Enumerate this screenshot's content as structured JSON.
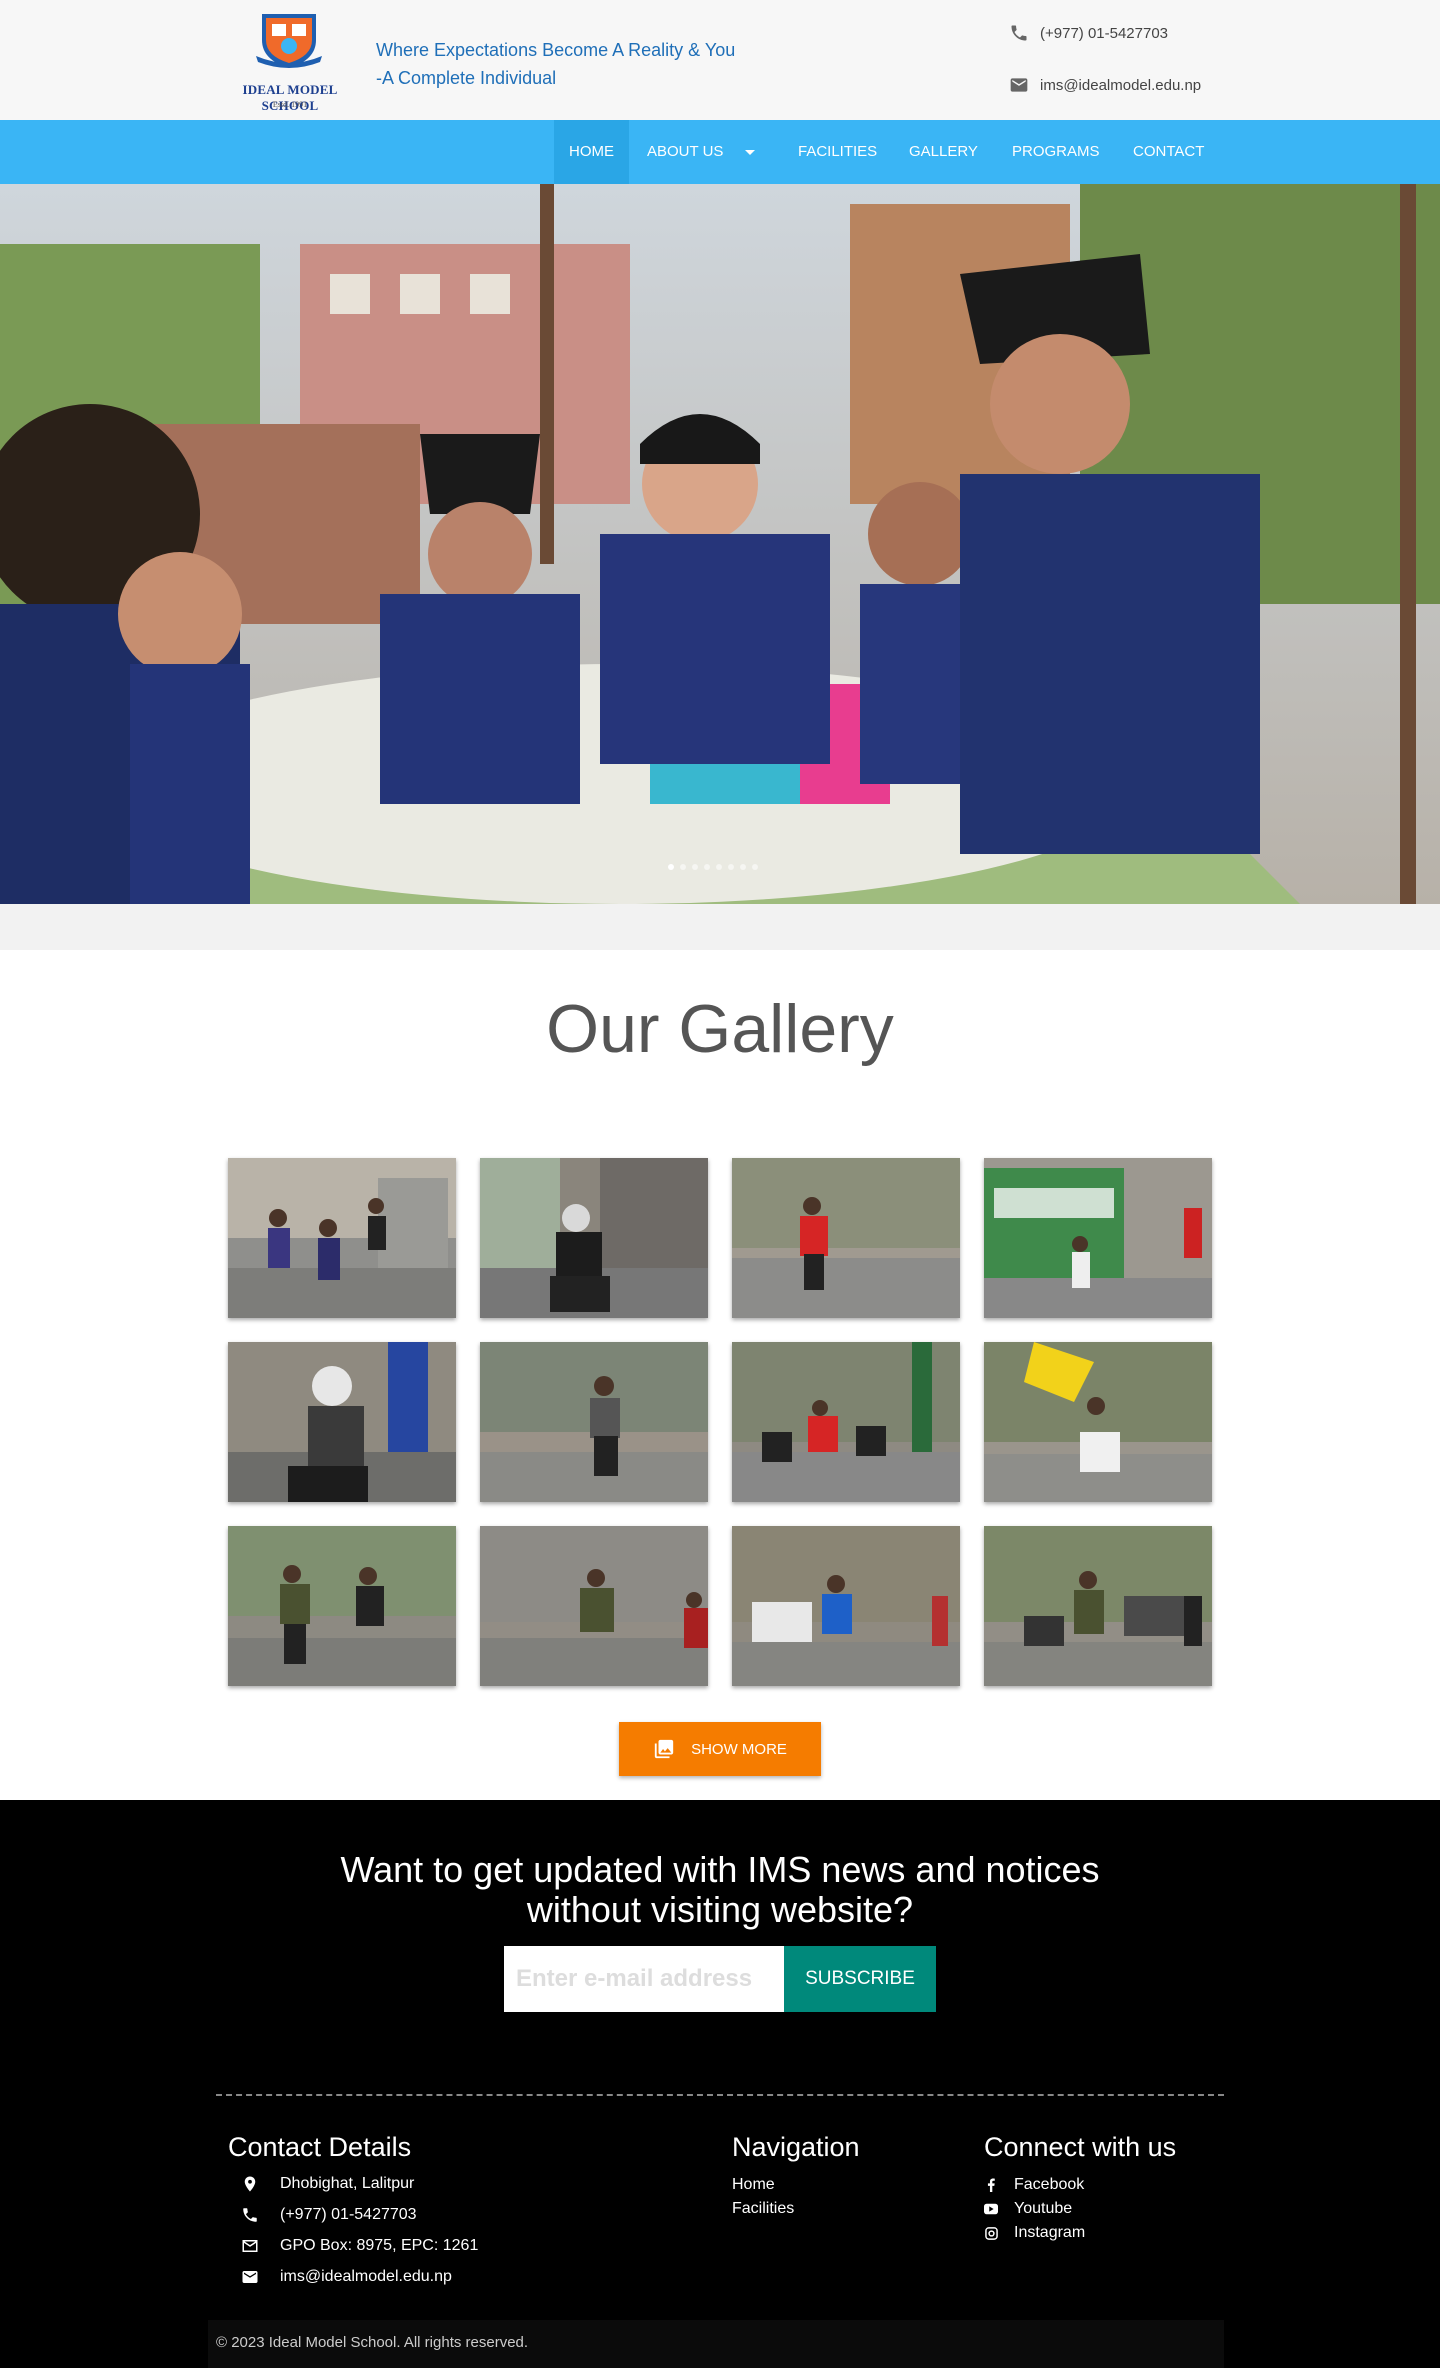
{
  "header": {
    "logo_name": "IDEAL MODEL SCHOOL",
    "logo_estd": "Estd. 1991",
    "tagline_line1": "Where Expectations Become A Reality & You",
    "tagline_line2": "-A Complete Individual",
    "phone": "(+977) 01-5427703",
    "email": "ims@idealmodel.edu.np"
  },
  "nav": {
    "home": "Home",
    "about": "About Us",
    "facilities": "Facilities",
    "gallery": "Gallery",
    "programs": "Programs",
    "contact": "Contact"
  },
  "hero": {
    "slide_count": 8,
    "active_slide": 1
  },
  "gallery": {
    "title": "Our Gallery",
    "show_more": "Show More"
  },
  "newsletter": {
    "title_line1": "Want to get updated with IMS news and notices",
    "title_line2": "without visiting website?",
    "placeholder": "Enter e-mail address",
    "button": "Subscribe"
  },
  "footer": {
    "contact_heading": "Contact Details",
    "address": "Dhobighat, Lalitpur",
    "phone": "(+977) 01-5427703",
    "po_box": "GPO Box: 8975, EPC: 1261",
    "email": "ims@idealmodel.edu.np",
    "nav_heading": "Navigation",
    "nav_home": "Home",
    "nav_facilities": "Facilities",
    "social_heading": "Connect with us",
    "facebook": "Facebook",
    "youtube": "Youtube",
    "instagram": "Instagram",
    "copyright": "© 2023 Ideal Model School. All rights reserved."
  },
  "colors": {
    "nav_bg": "#3ab5f5",
    "accent_orange": "#f57c00",
    "subscribe_teal": "#00897b",
    "tagline_blue": "#1f6fb8"
  }
}
